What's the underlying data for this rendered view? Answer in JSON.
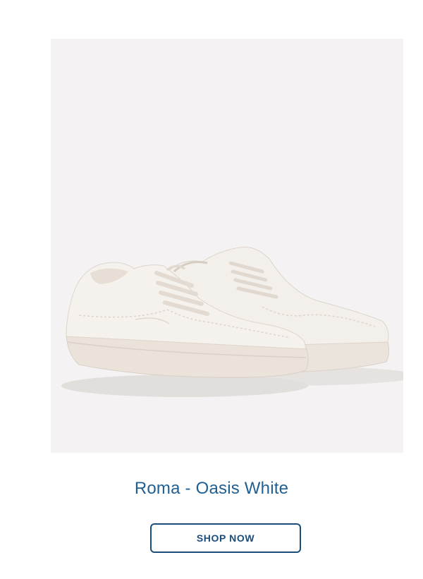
{
  "product": {
    "image_description": "shoe-pair-icon",
    "title": "Roma - Oasis White",
    "cta_label": "SHOP NOW"
  },
  "colors": {
    "title": "#1f5f92",
    "button_border": "#1b4d7a",
    "image_background": "#f4f2f2",
    "shoe": "#efe9e2"
  }
}
